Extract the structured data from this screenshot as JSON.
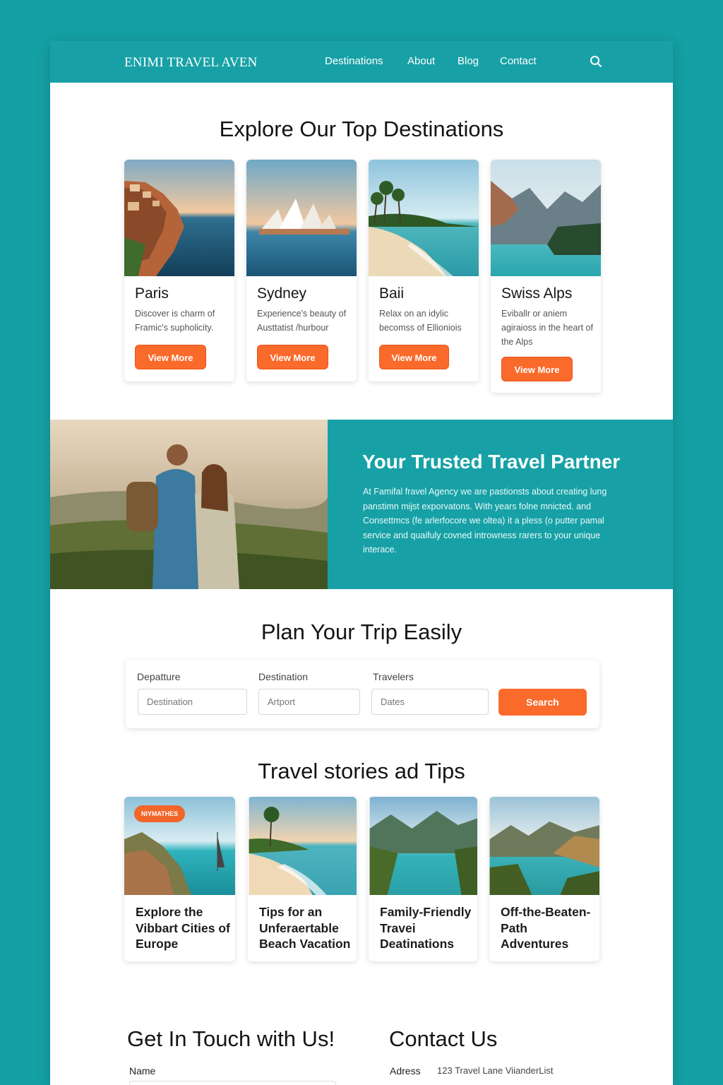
{
  "brand": "ENIMI TRAVEL AVEN",
  "nav": {
    "links": [
      "Destinations",
      "About",
      "Blog",
      "Contact"
    ],
    "search_icon": "search-icon"
  },
  "destinations": {
    "title": "Explore Our Top Destinations",
    "cards": [
      {
        "name": "Paris",
        "desc": "Discover is charm of Framic's supholicity.",
        "button": "View More"
      },
      {
        "name": "Sydney",
        "desc": "Experience's beauty of Austtatist /hurbour",
        "button": "View More"
      },
      {
        "name": "Baii",
        "desc": "Relax on an idylic becomss of Ellioniois",
        "button": "View More"
      },
      {
        "name": "Swiss Alps",
        "desc": "Eviballr or aniem agiraioss in the heart of the Alps",
        "button": "View More"
      }
    ]
  },
  "partner": {
    "title": "Your Trusted Travel Partner",
    "text": "At Famifal fravel Agency we are pastionsts about creating lung panstimn mijst exporvatons. With years folne mnicted. and Consettmcs (fe arlerfocore we oltea) it a pless (o putter pamal service and quaifuly covned introwness rarers to your unique interace."
  },
  "plan": {
    "title": "Plan Your Trip Easily",
    "labels": [
      "Depatture",
      "Destination",
      "Travelers"
    ],
    "placeholders": [
      "Destination",
      "Artport",
      "Dates"
    ],
    "button": "Search"
  },
  "stories": {
    "title": "Travel stories ad Tips",
    "badge": "NIYMATHES",
    "cards": [
      {
        "title": "Explore the Vibbart Cities of Europe"
      },
      {
        "title": "Tips for an Unferaertable Beach Vacation"
      },
      {
        "title": "Family-Friendly Travei Deatinations"
      },
      {
        "title": "Off-the-Beaten-Path Adventures"
      }
    ]
  },
  "contact": {
    "touch_title": "Get In Touch with Us!",
    "name_label": "Name",
    "us_title": "Contact Us",
    "address_label": "Adress",
    "address_value": "123 Travel Lane ViianderList"
  },
  "colors": {
    "teal": "#17a1a6",
    "orange": "#fa6a2a",
    "bg": "#14a0a4"
  }
}
